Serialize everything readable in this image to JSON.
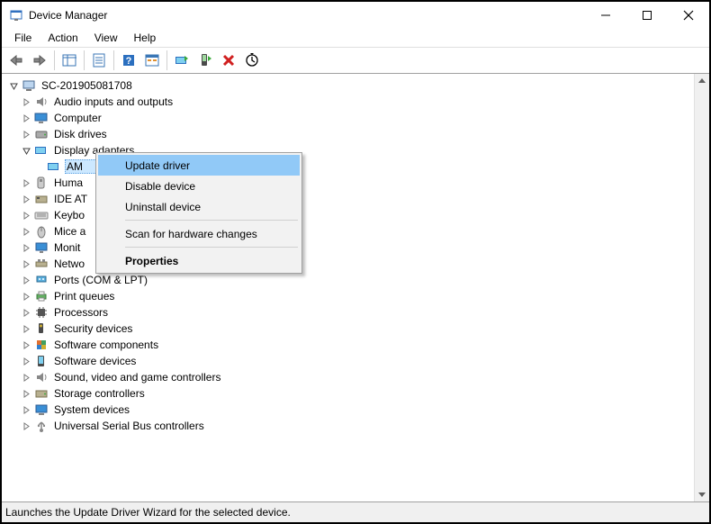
{
  "window": {
    "title": "Device Manager"
  },
  "menu": {
    "file": "File",
    "action": "Action",
    "view": "View",
    "help": "Help"
  },
  "tree": {
    "root": "SC-201905081708",
    "items": [
      "Audio inputs and outputs",
      "Computer",
      "Disk drives",
      "Display adapters",
      "AM",
      "Huma",
      "IDE AT",
      "Keybo",
      "Mice a",
      "Monit",
      "Netwo",
      "Ports (COM & LPT)",
      "Print queues",
      "Processors",
      "Security devices",
      "Software components",
      "Software devices",
      "Sound, video and game controllers",
      "Storage controllers",
      "System devices",
      "Universal Serial Bus controllers"
    ]
  },
  "context_menu": {
    "update": "Update driver",
    "disable": "Disable device",
    "uninstall": "Uninstall device",
    "scan": "Scan for hardware changes",
    "properties": "Properties"
  },
  "statusbar": {
    "text": "Launches the Update Driver Wizard for the selected device."
  }
}
